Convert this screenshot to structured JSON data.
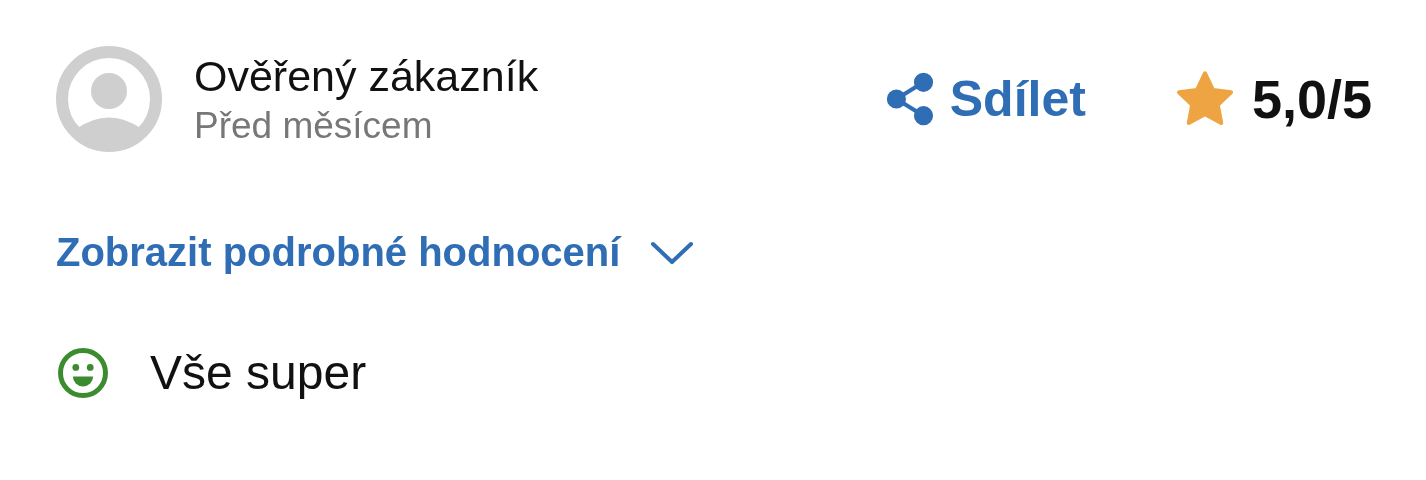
{
  "review": {
    "author": "Ověřený zákazník",
    "date": "Před měsícem",
    "share": {
      "label": "Sdílet"
    },
    "rating": "5,0/5"
  },
  "details_toggle": {
    "label": "Zobrazit podrobné hodnocení",
    "expanded": false
  },
  "points": [
    {
      "kind": "positive",
      "text": "Vše super"
    }
  ]
}
